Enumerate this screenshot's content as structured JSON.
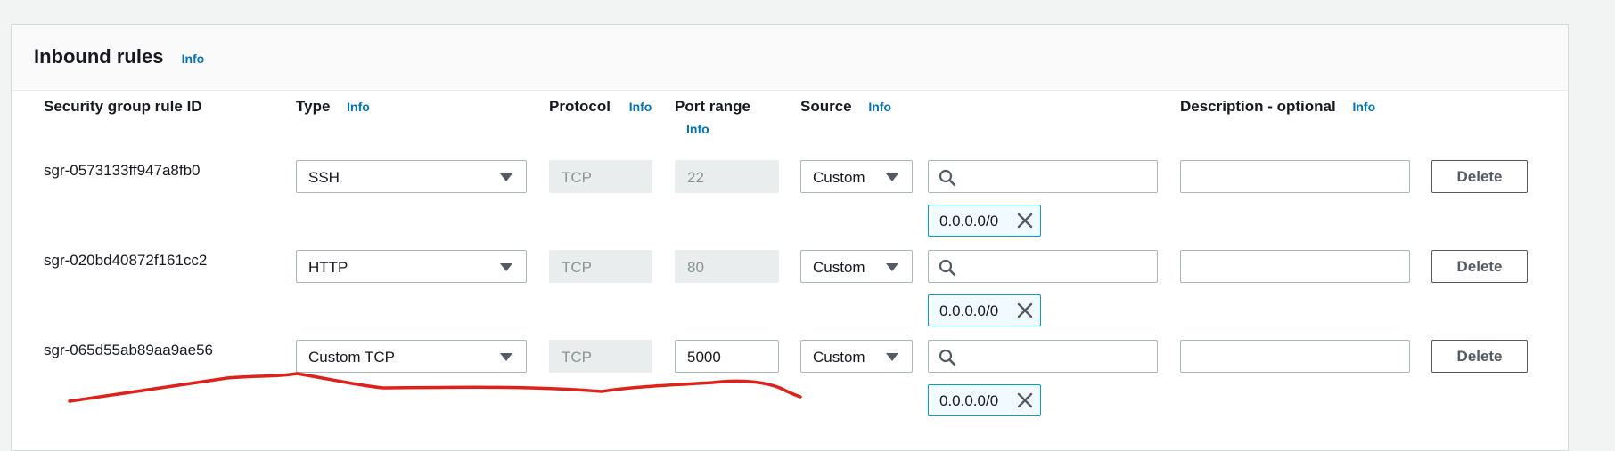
{
  "section": {
    "title": "Inbound rules",
    "info_label": "Info"
  },
  "columns": {
    "rule_id": "Security group rule ID",
    "type": "Type",
    "protocol": "Protocol",
    "port_range": "Port range",
    "source": "Source",
    "description": "Description - optional",
    "info": "Info"
  },
  "rules": [
    {
      "id": "sgr-0573133ff947a8fb0",
      "type": "SSH",
      "protocol": "TCP",
      "port": "22",
      "port_editable": false,
      "source_type": "Custom",
      "search_value": "",
      "cidr": "0.0.0.0/0",
      "description": "",
      "delete_label": "Delete"
    },
    {
      "id": "sgr-020bd40872f161cc2",
      "type": "HTTP",
      "protocol": "TCP",
      "port": "80",
      "port_editable": false,
      "source_type": "Custom",
      "search_value": "",
      "cidr": "0.0.0.0/0",
      "description": "",
      "delete_label": "Delete"
    },
    {
      "id": "sgr-065d55ab89aa9ae56",
      "type": "Custom TCP",
      "protocol": "TCP",
      "port": "5000",
      "port_editable": true,
      "source_type": "Custom",
      "search_value": "",
      "cidr": "0.0.0.0/0",
      "description": "",
      "delete_label": "Delete"
    }
  ],
  "icons": {
    "search": "search-icon",
    "dropdown": "caret-down-icon",
    "remove": "close-icon"
  },
  "colors": {
    "link": "#0073bb",
    "token_border": "#00a1c9",
    "token_bg": "#f1faff",
    "annotation": "#e0201b"
  }
}
